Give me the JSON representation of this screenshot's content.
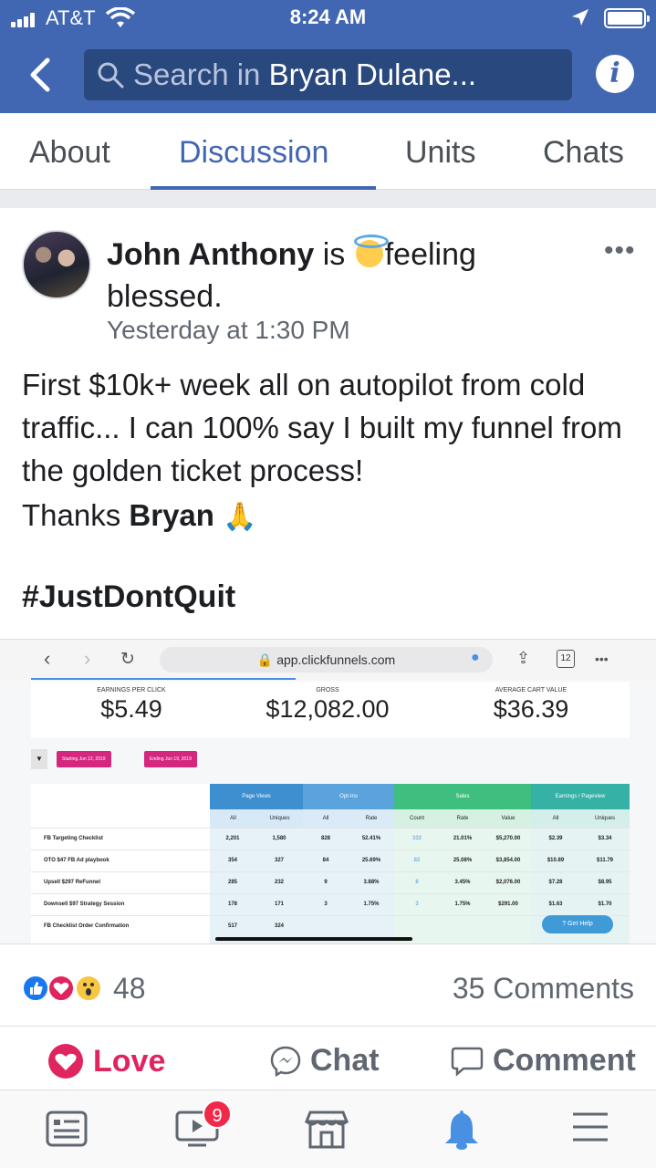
{
  "status_bar": {
    "carrier": "AT&T",
    "time": "8:24 AM"
  },
  "nav": {
    "search_placeholder": "Search in",
    "search_group": "Bryan Dulane..."
  },
  "tabs": [
    {
      "label": "About"
    },
    {
      "label": "Discussion",
      "active": true
    },
    {
      "label": "Units"
    },
    {
      "label": "Chats"
    }
  ],
  "post": {
    "author": "John Anthony",
    "feeling_prefix": "is",
    "feeling_word": "feeling",
    "feeling_state": "blessed.",
    "timestamp": "Yesterday at 1:30 PM",
    "body_text": "First $10k+ week all on autopilot from cold traffic... I can 100% say I built my funnel from the golden ticket process!",
    "thanks_prefix": "Thanks",
    "thanks_name": "Bryan",
    "hashtag": "#JustDontQuit"
  },
  "embedded": {
    "url": "app.clickfunnels.com",
    "tab_count": "12",
    "metrics": [
      {
        "label": "EARNINGS PER CLICK",
        "value": "$5.49"
      },
      {
        "label": "GROSS",
        "value": "$12,082.00"
      },
      {
        "label": "AVERAGE CART VALUE",
        "value": "$36.39"
      }
    ],
    "filters": {
      "start": "Starting  Jun 12, 2019",
      "end": "Ending  Jun 19, 2019"
    },
    "groups": [
      "Page Views",
      "Opt-Ins",
      "Sales",
      "Earnings / Pageview"
    ],
    "subheaders": [
      "All",
      "Uniques",
      "All",
      "Rate",
      "Count",
      "Rate",
      "Value",
      "All",
      "Uniques"
    ],
    "rows": [
      {
        "name": "FB Targeting Checklist",
        "cells": [
          "2,201",
          "1,580",
          "828",
          "52.41%",
          "332",
          "21.01%",
          "$5,270.00",
          "$2.39",
          "$3.34"
        ]
      },
      {
        "name": "OTO $47 FB Ad playbook",
        "cells": [
          "354",
          "327",
          "84",
          "25.69%",
          "82",
          "25.08%",
          "$3,854.00",
          "$10.89",
          "$11.79"
        ]
      },
      {
        "name": "Upsell $297 ReFunnel",
        "cells": [
          "285",
          "232",
          "9",
          "3.88%",
          "8",
          "3.45%",
          "$2,076.00",
          "$7.28",
          "$8.95"
        ]
      },
      {
        "name": "Downsell $97 Strategy Session",
        "cells": [
          "178",
          "171",
          "3",
          "1.75%",
          "3",
          "1.75%",
          "$291.00",
          "$1.63",
          "$1.70"
        ]
      },
      {
        "name": "FB Checklist Order Confirmation",
        "cells": [
          "517",
          "324",
          "",
          "",
          "",
          "",
          "",
          "",
          ""
        ]
      }
    ],
    "get_help": "Get Help"
  },
  "reactions": {
    "count": "48",
    "comments": "35 Comments"
  },
  "actions": {
    "love": "Love",
    "chat": "Chat",
    "comment": "Comment"
  },
  "notifications": {
    "video_badge": "9"
  },
  "colors": {
    "brand": "#4267b2",
    "love": "#e0245e"
  }
}
